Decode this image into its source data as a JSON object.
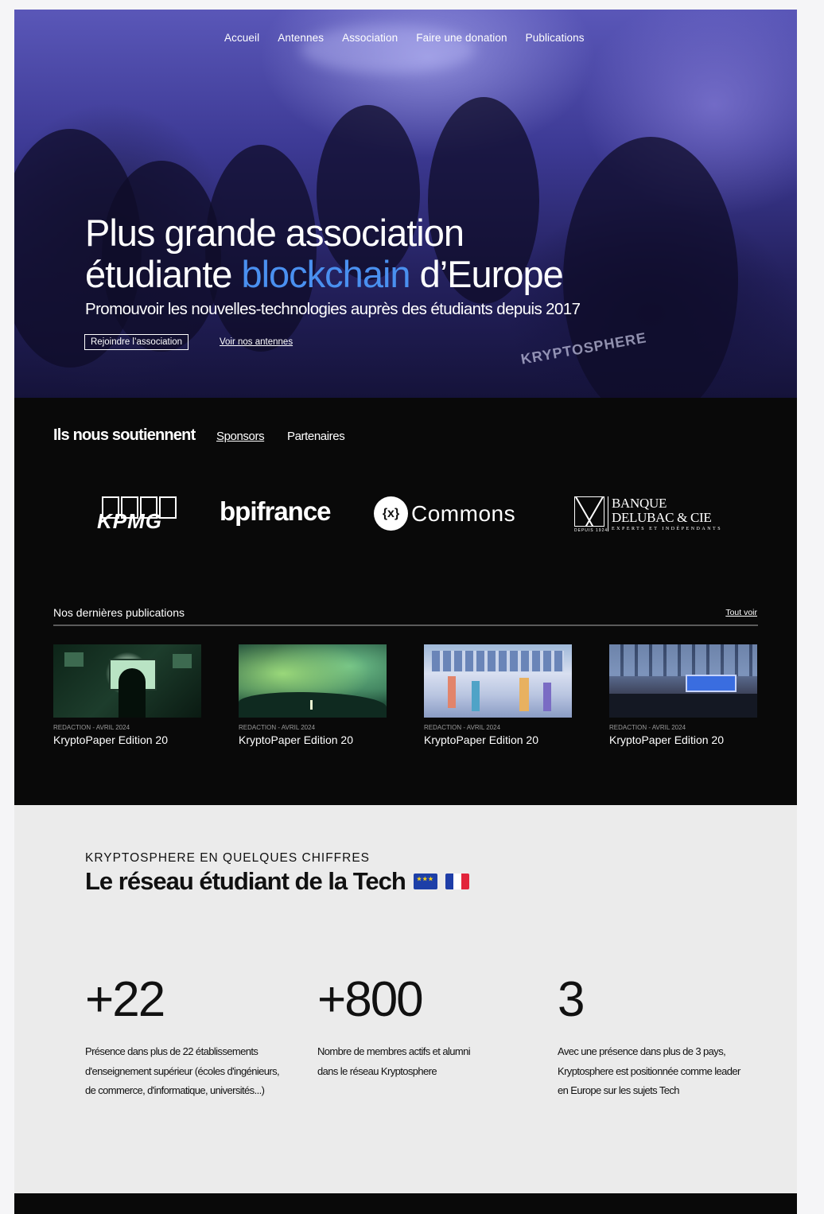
{
  "nav": {
    "items": [
      "Accueil",
      "Antennes",
      "Association",
      "Faire une donation",
      "Publications"
    ]
  },
  "hero": {
    "title_line1": "Plus grande association",
    "title_line2_pre": "étudiante ",
    "title_line2_accent": "blockchain",
    "title_line2_post": " d’Europe",
    "subtitle": "Promouvoir les nouvelles-technologies auprès des étudiants depuis 2017",
    "join_button": "Rejoindre l’association",
    "antennes_link": "Voir nos antennes",
    "shirt_text": "KRYPTOSPHERE",
    "accent_color": "#4a90f0"
  },
  "supporters": {
    "title": "Ils nous soutiennent",
    "tab_sponsors": "Sponsors",
    "tab_partners": "Partenaires",
    "logos": {
      "kpmg": "KPMG",
      "bpifrance": "bpifrance",
      "commons_symbol": "{x}",
      "commons": "Commons",
      "banque_line1": "BANQUE",
      "banque_line2": "DELUBAC & CIE",
      "banque_tagline": "EXPERTS ET INDÉPENDANTS",
      "banque_since": "DEPUIS 1924"
    }
  },
  "publications": {
    "title": "Nos dernières publications",
    "see_all": "Tout voir",
    "items": [
      {
        "meta": "REDACTION - AVRIL 2024",
        "name": "KryptoPaper Edition 20"
      },
      {
        "meta": "REDACTION - AVRIL 2024",
        "name": "KryptoPaper Edition 20"
      },
      {
        "meta": "REDACTION - AVRIL 2024",
        "name": "KryptoPaper Edition 20"
      },
      {
        "meta": "REDACTION - AVRIL 2024",
        "name": "KryptoPaper Edition 20"
      }
    ]
  },
  "stats": {
    "kicker": "KRYPTOSPHERE EN QUELQUES CHIFFRES",
    "title": "Le réseau étudiant de la Tech",
    "items": [
      {
        "number": "+22",
        "desc": "Présence dans plus de 22 établissements d'enseignement supérieur (écoles d'ingénieurs, de commerce, d'informatique, universités...)"
      },
      {
        "number": "+800",
        "desc": "Nombre de membres actifs et alumni dans le réseau Kryptosphere"
      },
      {
        "number": "3",
        "desc": "Avec une présence dans plus de 3 pays, Kryptosphere est positionnée comme leader en Europe sur les sujets Tech"
      }
    ]
  }
}
